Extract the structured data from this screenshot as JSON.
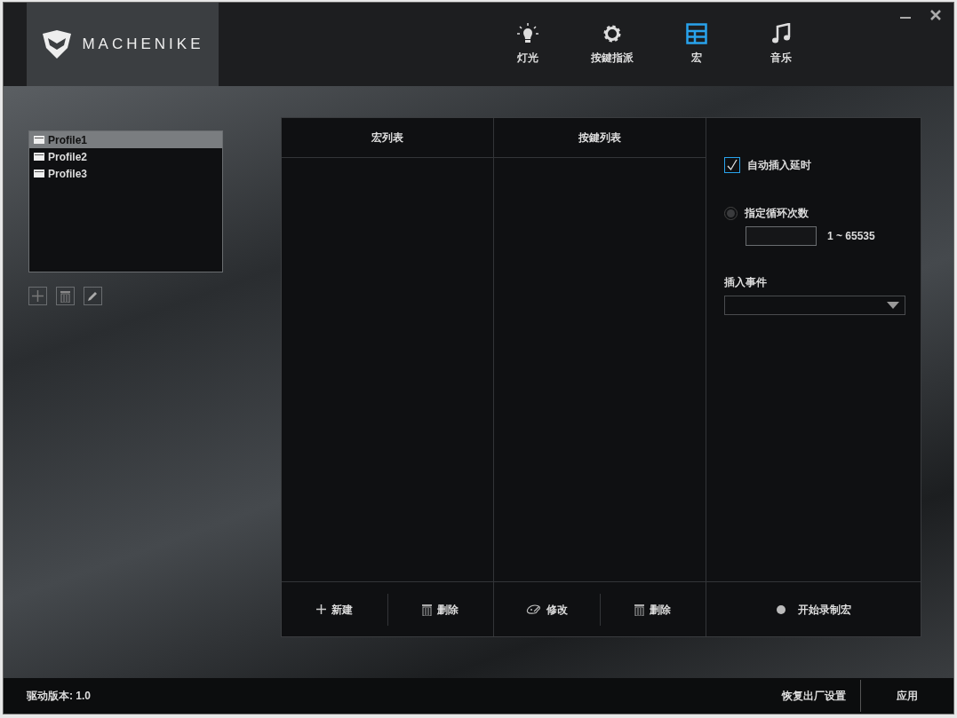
{
  "logo": {
    "text": "MACHENIKE"
  },
  "tabs": [
    {
      "label": "灯光",
      "kind": "light",
      "selected": false
    },
    {
      "label": "按鍵指派",
      "kind": "gear",
      "selected": false
    },
    {
      "label": "宏",
      "kind": "grid",
      "selected": true
    },
    {
      "label": "音乐",
      "kind": "music",
      "selected": false
    }
  ],
  "profiles": [
    {
      "label": "Profile1",
      "selected": true
    },
    {
      "label": "Profile2",
      "selected": false
    },
    {
      "label": "Profile3",
      "selected": false
    }
  ],
  "macro_list": {
    "title": "宏列表",
    "actions": [
      {
        "label": "新建",
        "kind": "add"
      },
      {
        "label": "删除",
        "kind": "delete"
      }
    ]
  },
  "key_list": {
    "title": "按鍵列表",
    "actions": [
      {
        "label": "修改",
        "kind": "edit"
      },
      {
        "label": "删除",
        "kind": "delete"
      }
    ]
  },
  "options": {
    "auto_delay": {
      "label": "自动插入延时",
      "checked": true
    },
    "loop": {
      "label": "指定循环次数",
      "selected": false,
      "range": "1 ~ 65535"
    },
    "insert_event": {
      "label": "插入事件"
    },
    "record": {
      "label": "开始录制宏"
    }
  },
  "status_bar": {
    "version": "驱动版本: 1.0",
    "buttons": [
      "恢复出厂设置",
      "应用"
    ]
  }
}
